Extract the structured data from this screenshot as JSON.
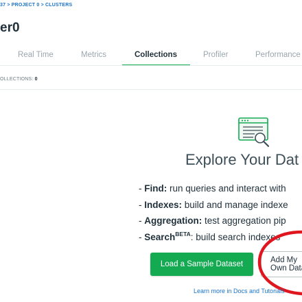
{
  "breadcrumb": "37 > PROJECT 0 > CLUSTERS",
  "page_title": "er0",
  "tabs": [
    {
      "label": "Real Time"
    },
    {
      "label": "Metrics"
    },
    {
      "label": "Collections"
    },
    {
      "label": "Profiler"
    },
    {
      "label": "Performance"
    }
  ],
  "active_tab": "Collections",
  "summary": {
    "label": "OLLECTIONS:",
    "value": "0"
  },
  "explore": {
    "title": "Explore Your Dat",
    "features": [
      {
        "prefix": "- ",
        "name": "Find:",
        "sup": "",
        "text": " run queries and interact with"
      },
      {
        "prefix": "- ",
        "name": "Indexes:",
        "sup": "",
        "text": " build and manage indexe"
      },
      {
        "prefix": "- ",
        "name": "Aggregation:",
        "sup": "",
        "text": " test aggregation pip"
      },
      {
        "prefix": "- ",
        "name": "Search",
        "sup": "BETA",
        "text": ": build search indexes"
      }
    ],
    "primary_button": "Load a Sample Dataset",
    "secondary_button": "Add My Own Data",
    "learn_more": "Learn more in Docs and Tutorials"
  },
  "colors": {
    "accent": "#13aa52",
    "link": "#1a73c9",
    "annotation": "#e0161e"
  }
}
